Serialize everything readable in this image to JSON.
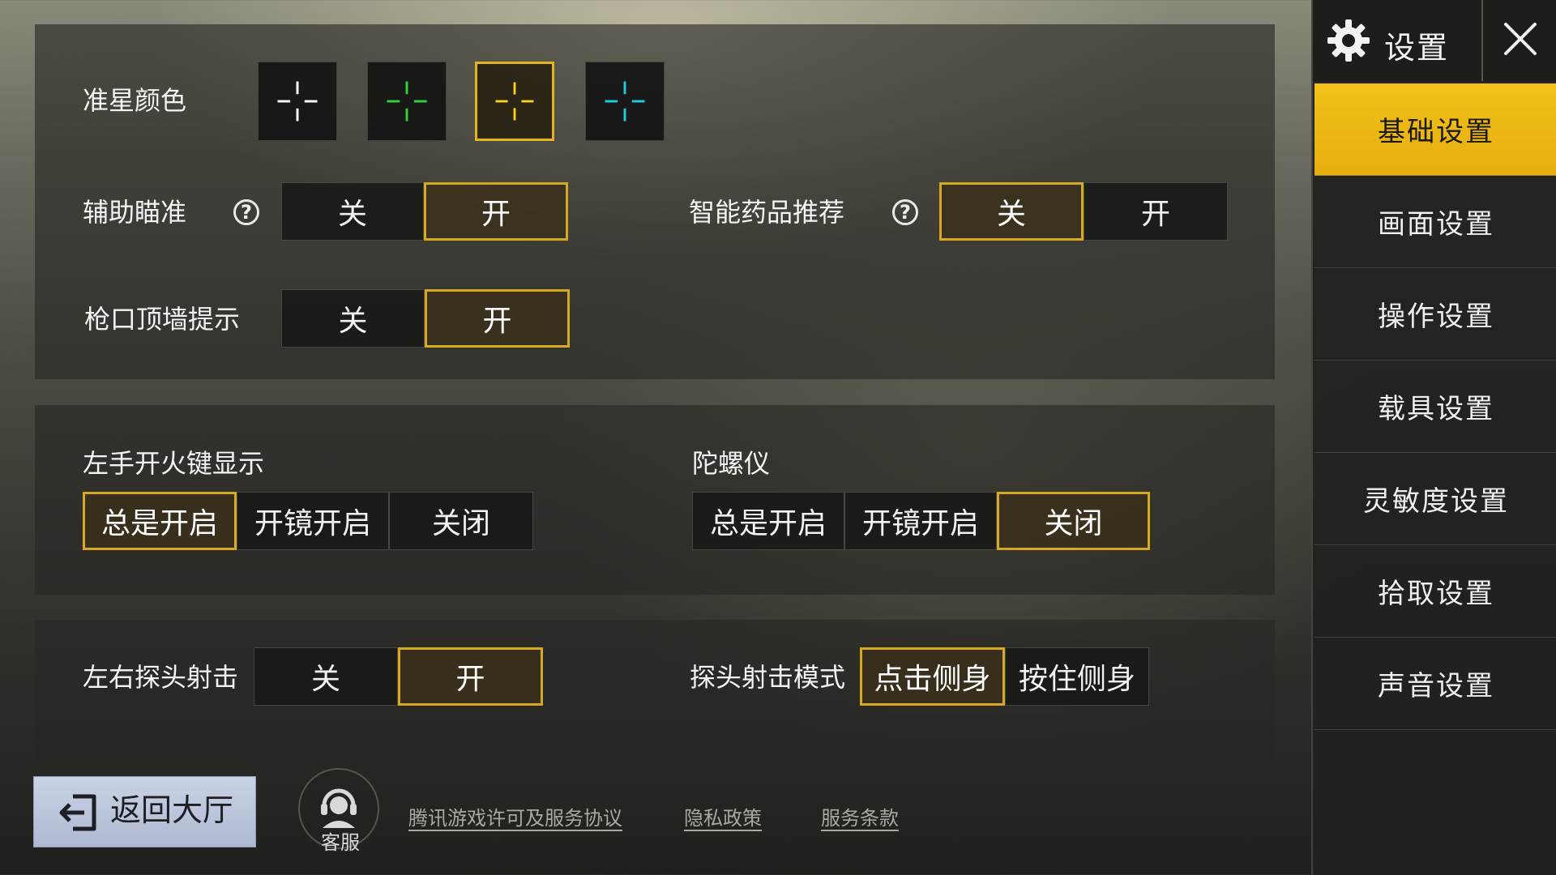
{
  "header": {
    "title": "设置"
  },
  "sidebar": {
    "items": [
      {
        "label": "基础设置",
        "active": true
      },
      {
        "label": "画面设置"
      },
      {
        "label": "操作设置"
      },
      {
        "label": "载具设置"
      },
      {
        "label": "灵敏度设置"
      },
      {
        "label": "拾取设置"
      },
      {
        "label": "声音设置"
      }
    ]
  },
  "crosshair": {
    "label": "准星颜色",
    "colors": [
      "#ffffff",
      "#2fd23c",
      "#ffd21c",
      "#20c8e0"
    ],
    "selected_index": 2
  },
  "aim_assist": {
    "label": "辅助瞄准",
    "help": "?",
    "off": "关",
    "on": "开",
    "selected": "开"
  },
  "smart_meds": {
    "label": "智能药品推荐",
    "help": "?",
    "off": "关",
    "on": "开",
    "selected": "关"
  },
  "muzzle_wall": {
    "label": "枪口顶墙提示",
    "off": "关",
    "on": "开",
    "selected": "开"
  },
  "left_fire": {
    "label": "左手开火键显示",
    "options": [
      "总是开启",
      "开镜开启",
      "关闭"
    ],
    "selected": "总是开启"
  },
  "gyroscope": {
    "label": "陀螺仪",
    "options": [
      "总是开启",
      "开镜开启",
      "关闭"
    ],
    "selected": "关闭"
  },
  "peek_fire": {
    "label": "左右探头射击",
    "off": "关",
    "on": "开",
    "selected": "开"
  },
  "peek_mode": {
    "label": "探头射击模式",
    "options": [
      "点击侧身",
      "按住侧身"
    ],
    "selected": "点击侧身"
  },
  "footer": {
    "back_label": "返回大厅",
    "service_label": "客服",
    "links": [
      "腾讯游戏许可及服务协议",
      "隐私政策",
      "服务条款"
    ]
  },
  "colors": {
    "accent": "#e6ad0e",
    "selected_border": "#d7a922"
  }
}
